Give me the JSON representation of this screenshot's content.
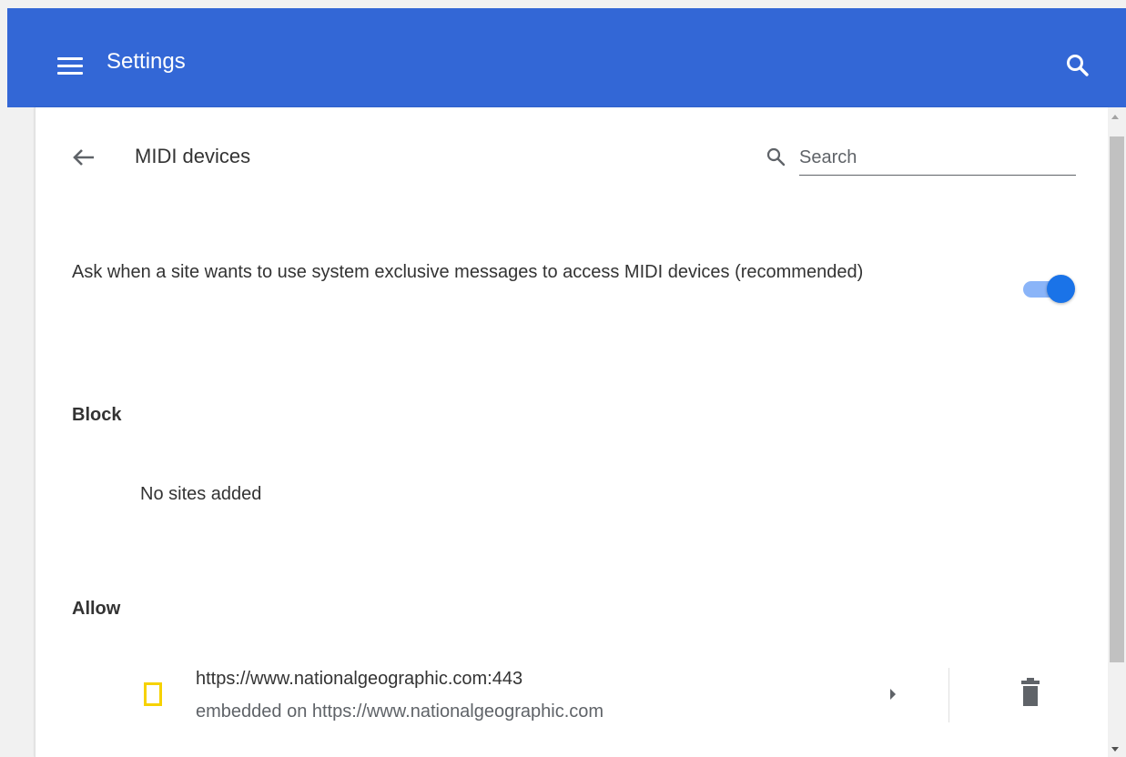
{
  "header": {
    "title": "Settings",
    "menu_icon": "hamburger-menu-icon",
    "search_icon": "search-icon",
    "color": "#3367d6"
  },
  "subpage": {
    "back_icon": "arrow-back-icon",
    "title": "MIDI devices",
    "search": {
      "placeholder": "Search",
      "value": ""
    }
  },
  "setting": {
    "label": "Ask when a site wants to use system exclusive messages to access MIDI devices (recommended)",
    "toggle_on": true,
    "toggle_color": "#1a73e8"
  },
  "block": {
    "heading": "Block",
    "empty_text": "No sites added"
  },
  "allow": {
    "heading": "Allow",
    "sites": [
      {
        "url": "https://www.nationalgeographic.com:443",
        "embedded": "embedded on https://www.nationalgeographic.com",
        "favicon": "national-geographic-favicon",
        "favicon_color": "#f6d200",
        "expand_icon": "arrow-right-icon",
        "delete_icon": "trash-icon"
      }
    ]
  }
}
